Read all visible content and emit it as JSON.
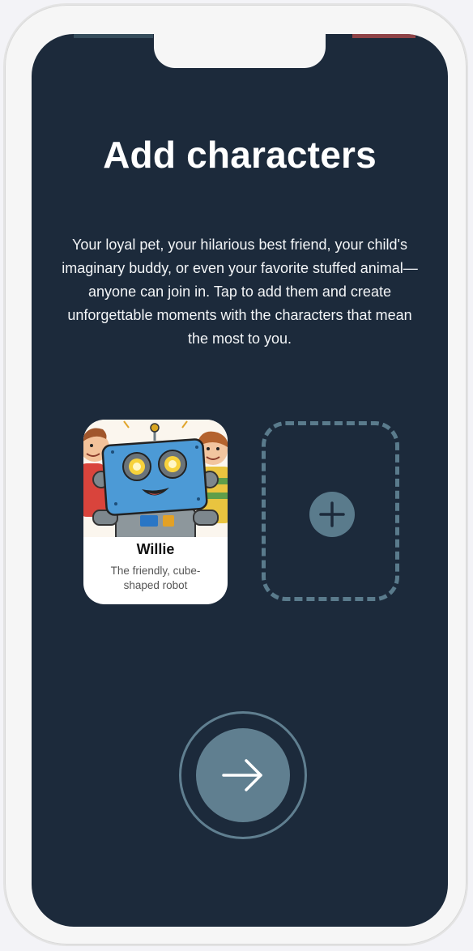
{
  "page": {
    "title": "Add characters",
    "description": "Your loyal pet, your hilarious best friend, your child's imaginary buddy, or even your favorite stuffed animal—anyone can join in. Tap to add them and create unforgettable moments with the characters that mean the most to you."
  },
  "characters": [
    {
      "name": "Willie",
      "description": "The friendly, cube-shaped robot",
      "image": "robot-illustration"
    }
  ],
  "icons": {
    "add": "plus-icon",
    "next": "arrow-right-icon"
  },
  "colors": {
    "background": "#1c2a3b",
    "accent": "#607f90",
    "text": "#ffffff"
  }
}
